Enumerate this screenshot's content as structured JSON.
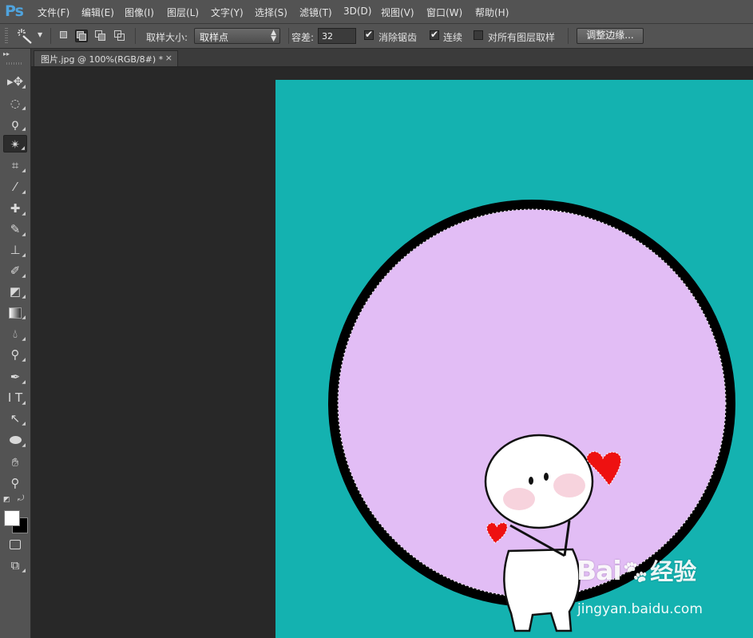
{
  "app": {
    "logo": "Ps"
  },
  "menu": [
    "文件(F)",
    "编辑(E)",
    "图像(I)",
    "图层(L)",
    "文字(Y)",
    "选择(S)",
    "滤镜(T)",
    "3D(D)",
    "视图(V)",
    "窗口(W)",
    "帮助(H)"
  ],
  "options": {
    "tool_icon": "magic-wand-icon",
    "sample_size_label": "取样大小:",
    "sample_size_value": "取样点",
    "tolerance_label": "容差:",
    "tolerance_value": "32",
    "anti_alias_label": "消除锯齿",
    "anti_alias_checked": true,
    "contiguous_label": "连续",
    "contiguous_checked": true,
    "sample_all_layers_label": "对所有图层取样",
    "sample_all_layers_checked": false,
    "refine_edge_label": "调整边缘..."
  },
  "document": {
    "tab_title": "图片.jpg @ 100%(RGB/8#) *",
    "tab_close": "×",
    "canvas_background": "#14b2b0",
    "circle_fill": "#e2bdf5",
    "circle_stroke": "#000000"
  },
  "tools": [
    "move-icon",
    "elliptical-marquee-icon",
    "lasso-icon",
    "magic-wand-icon",
    "crop-icon",
    "eyedropper-icon",
    "healing-brush-icon",
    "brush-icon",
    "clone-stamp-icon",
    "history-brush-icon",
    "eraser-icon",
    "gradient-icon",
    "blur-icon",
    "dodge-icon",
    "pen-icon",
    "type-icon",
    "path-selection-icon",
    "ellipse-shape-icon",
    "hand-icon",
    "zoom-icon",
    "quick-mask-icon",
    "screen-mode-icon"
  ],
  "colors": {
    "foreground": "#ffffff",
    "background": "#000000"
  },
  "watermark": {
    "logo_text": "Bai",
    "logo_suffix": "经验",
    "url": "jingyan.baidu.com"
  }
}
